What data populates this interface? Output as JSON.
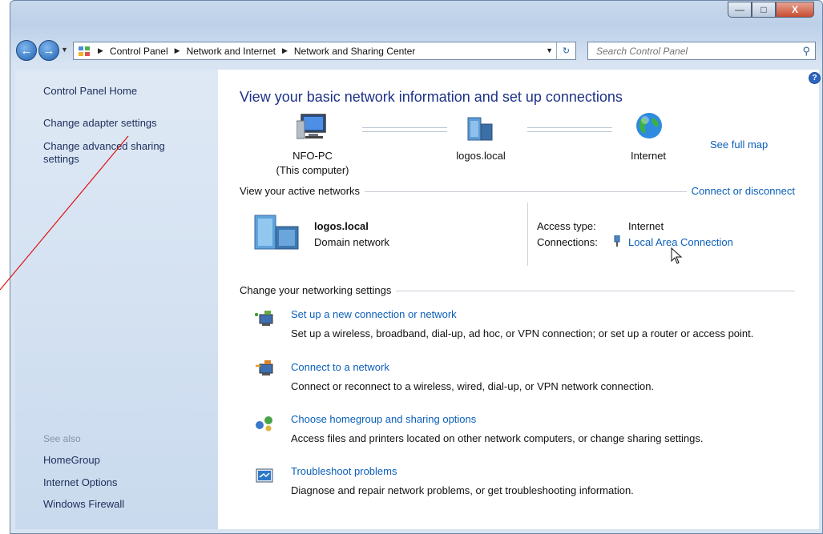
{
  "address_bar": {
    "crumbs": [
      "Control Panel",
      "Network and Internet",
      "Network and Sharing Center"
    ],
    "search_placeholder": "Search Control Panel"
  },
  "left_pane": {
    "home": "Control Panel Home",
    "change_adapter": "Change adapter settings",
    "change_advanced_line1": "Change advanced sharing",
    "change_advanced_line2": "settings",
    "see_also": "See also",
    "homegroup": "HomeGroup",
    "internet_options": "Internet Options",
    "windows_firewall": "Windows Firewall"
  },
  "main": {
    "title": "View your basic network information and set up connections",
    "see_full_map": "See full map",
    "map": {
      "computer_name": "NFO-PC",
      "computer_sub": "(This computer)",
      "domain": "logos.local",
      "internet": "Internet"
    },
    "active_networks_label": "View your active networks",
    "connect_disconnect": "Connect or disconnect",
    "network": {
      "name": "logos.local",
      "type": "Domain network",
      "access_type_label": "Access type:",
      "access_type_value": "Internet",
      "connections_label": "Connections:",
      "connection_link": "Local Area Connection"
    },
    "change_settings_label": "Change your networking settings",
    "tasks": [
      {
        "link": "Set up a new connection or network",
        "desc": "Set up a wireless, broadband, dial-up, ad hoc, or VPN connection; or set up a router or access point."
      },
      {
        "link": "Connect to a network",
        "desc": "Connect or reconnect to a wireless, wired, dial-up, or VPN network connection."
      },
      {
        "link": "Choose homegroup and sharing options",
        "desc": "Access files and printers located on other network computers, or change sharing settings."
      },
      {
        "link": "Troubleshoot problems",
        "desc": "Diagnose and repair network problems, or get troubleshooting information."
      }
    ]
  },
  "colors": {
    "title_blue": "#1e3287",
    "link_blue": "#0b5fb8",
    "left_pane_text": "#1c2e59",
    "annotation_red": "#e01010"
  }
}
